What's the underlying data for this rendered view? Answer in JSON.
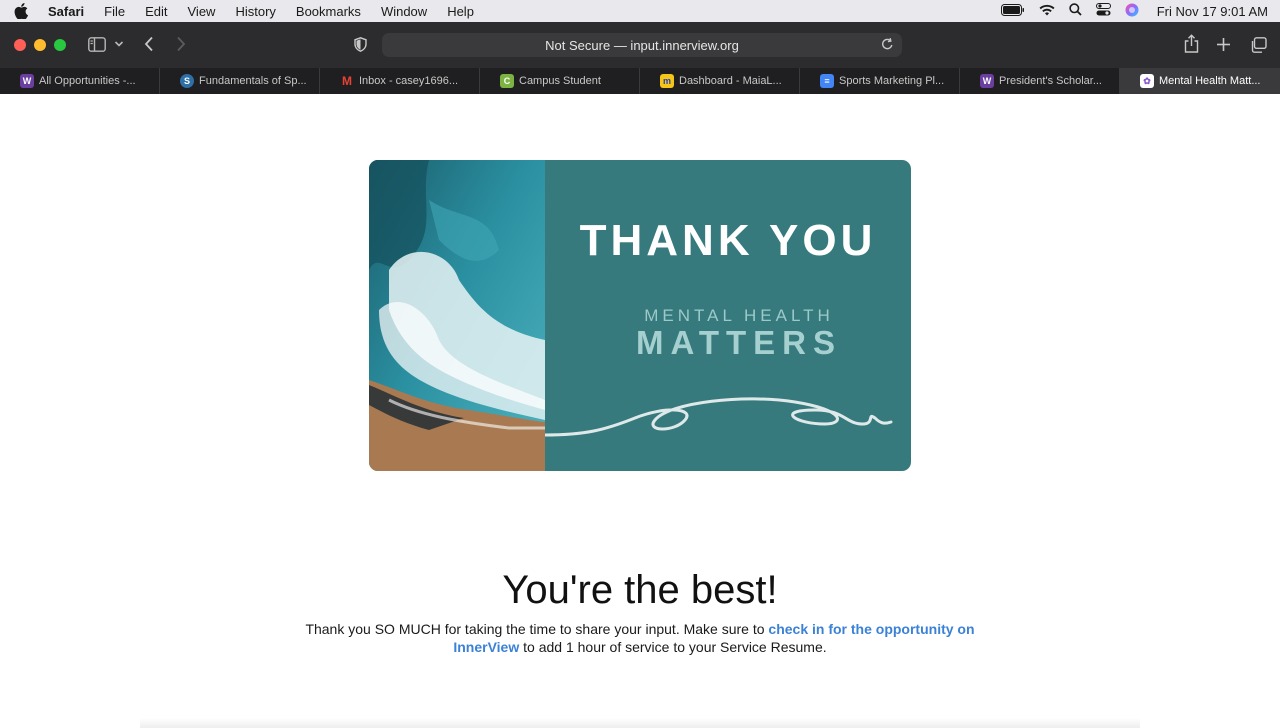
{
  "menubar": {
    "app": "Safari",
    "items": [
      "File",
      "Edit",
      "View",
      "History",
      "Bookmarks",
      "Window",
      "Help"
    ],
    "clock": "Fri Nov 17  9:01 AM"
  },
  "toolbar": {
    "address": "Not Secure — input.innerview.org"
  },
  "tabs": [
    {
      "label": "All Opportunities -...",
      "favicon": "W",
      "color": "#6b3fa0"
    },
    {
      "label": "Fundamentals of Sp...",
      "favicon": "S",
      "color": "#2e6fa7"
    },
    {
      "label": "Inbox - casey1696...",
      "favicon": "M",
      "color": "#d93025"
    },
    {
      "label": "Campus Student",
      "favicon": "C",
      "color": "#7cb342"
    },
    {
      "label": "Dashboard - MaiaL...",
      "favicon": "m",
      "color": "#1f5fbf"
    },
    {
      "label": "Sports Marketing Pl...",
      "favicon": "≡",
      "color": "#4285f4"
    },
    {
      "label": "President's Scholar...",
      "favicon": "W",
      "color": "#6b3fa0"
    },
    {
      "label": "Mental Health Matt...",
      "favicon": "✿",
      "color": "#8a5cc9"
    }
  ],
  "card": {
    "thank_you": "THANK YOU",
    "mental_health": "MENTAL  HEALTH",
    "matters": "MATTERS"
  },
  "page": {
    "headline": "You're the best!",
    "text_before": "Thank you SO MUCH for taking the time to share your input. Make sure to ",
    "link_text": "check in for the opportunity on InnerView",
    "text_after": " to add 1 hour of service to your Service Resume."
  }
}
